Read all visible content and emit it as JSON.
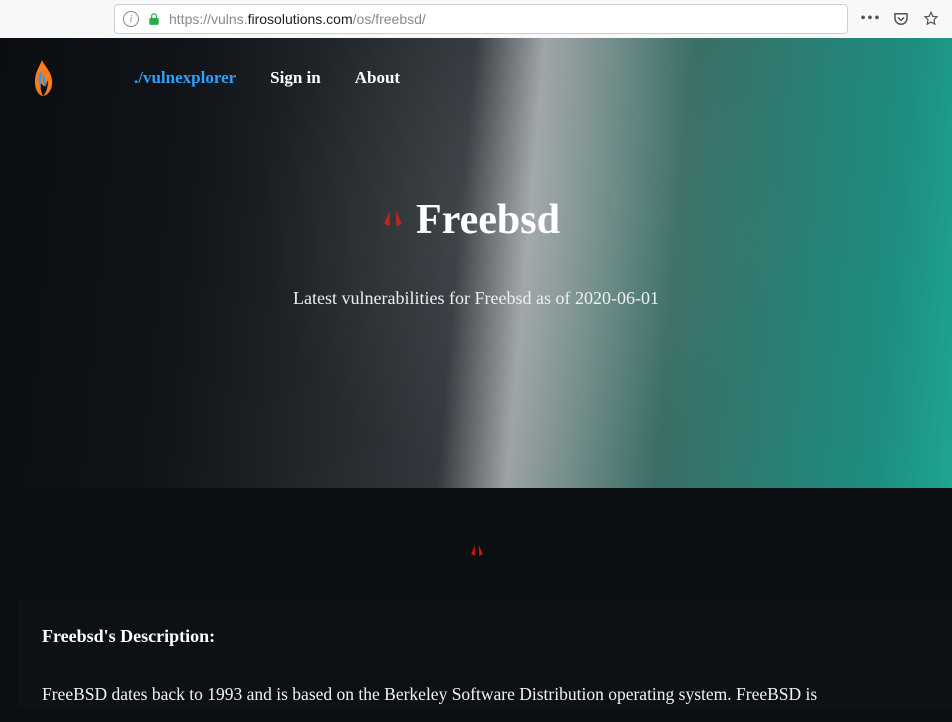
{
  "browser": {
    "url_prefix": "https://vulns.",
    "url_domain": "firosolutions.com",
    "url_path": "/os/freebsd/"
  },
  "nav": {
    "brand": "./vulnexplorer",
    "signin": "Sign in",
    "about": "About"
  },
  "hero": {
    "title": "Freebsd",
    "subtitle": "Latest vulnerabilities for Freebsd as of 2020-06-01"
  },
  "description": {
    "heading": "Freebsd's Description:",
    "body": "FreeBSD dates back to 1993 and is based on the Berkeley Software Distribution operating system. FreeBSD is"
  }
}
